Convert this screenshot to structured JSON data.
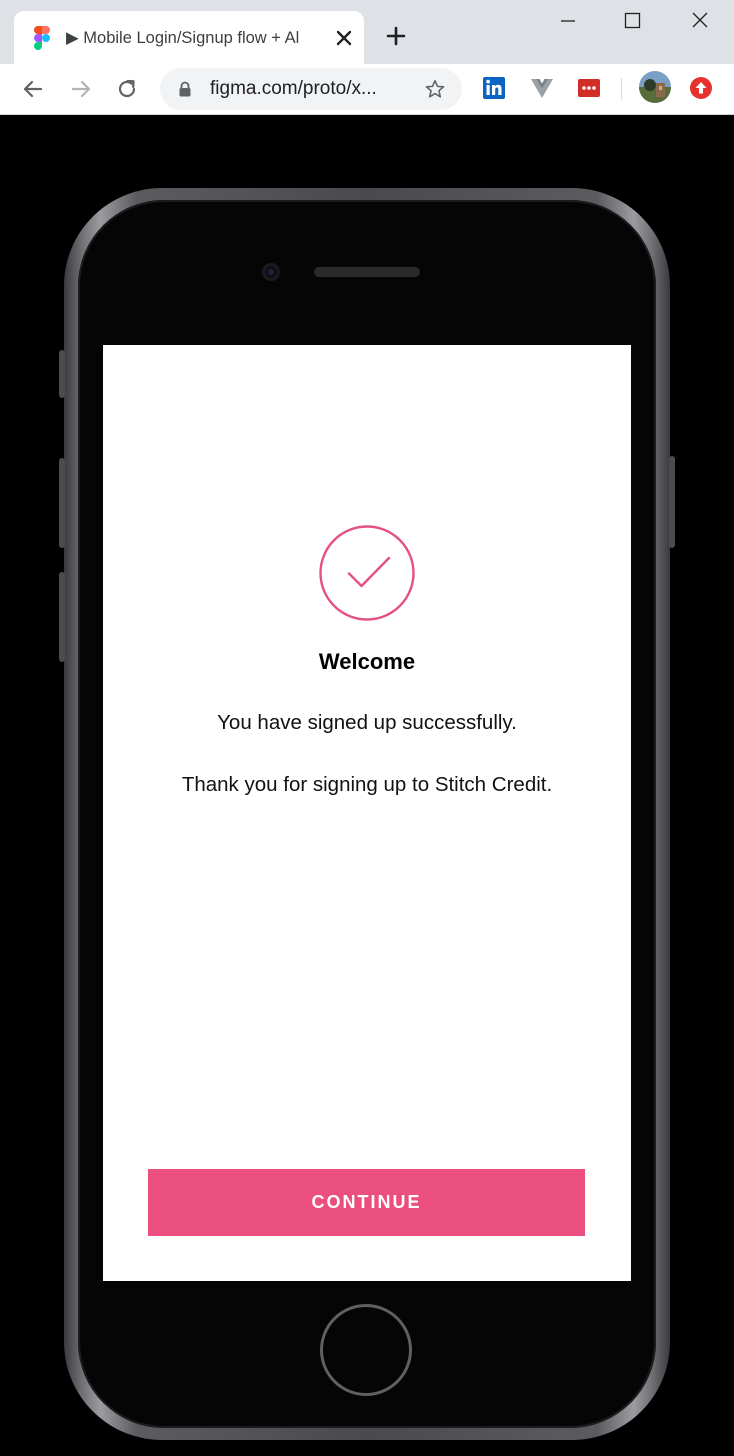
{
  "browser": {
    "tab_title": "▶ Mobile Login/Signup flow + Al",
    "url": "figma.com/proto/x...",
    "icons": {
      "favicon": "figma-icon",
      "tab_close": "close-icon",
      "new_tab": "plus-icon",
      "back": "arrow-left-icon",
      "forward": "arrow-right-icon",
      "reload": "reload-icon",
      "lock": "lock-icon",
      "bookmark": "star-icon",
      "extensions": [
        "linkedin-icon",
        "vue-devtools-icon",
        "lastpass-icon",
        "profile-avatar",
        "upload-icon"
      ]
    }
  },
  "app": {
    "title": "Welcome",
    "message": "You have signed up successfully.",
    "thanks": "Thank you for signing up to Stitch Credit.",
    "continue_label": "CONTINUE"
  },
  "colors": {
    "accent": "#eb4f7f",
    "check": "#e4527f",
    "device_frame": "#4a4a4e"
  }
}
